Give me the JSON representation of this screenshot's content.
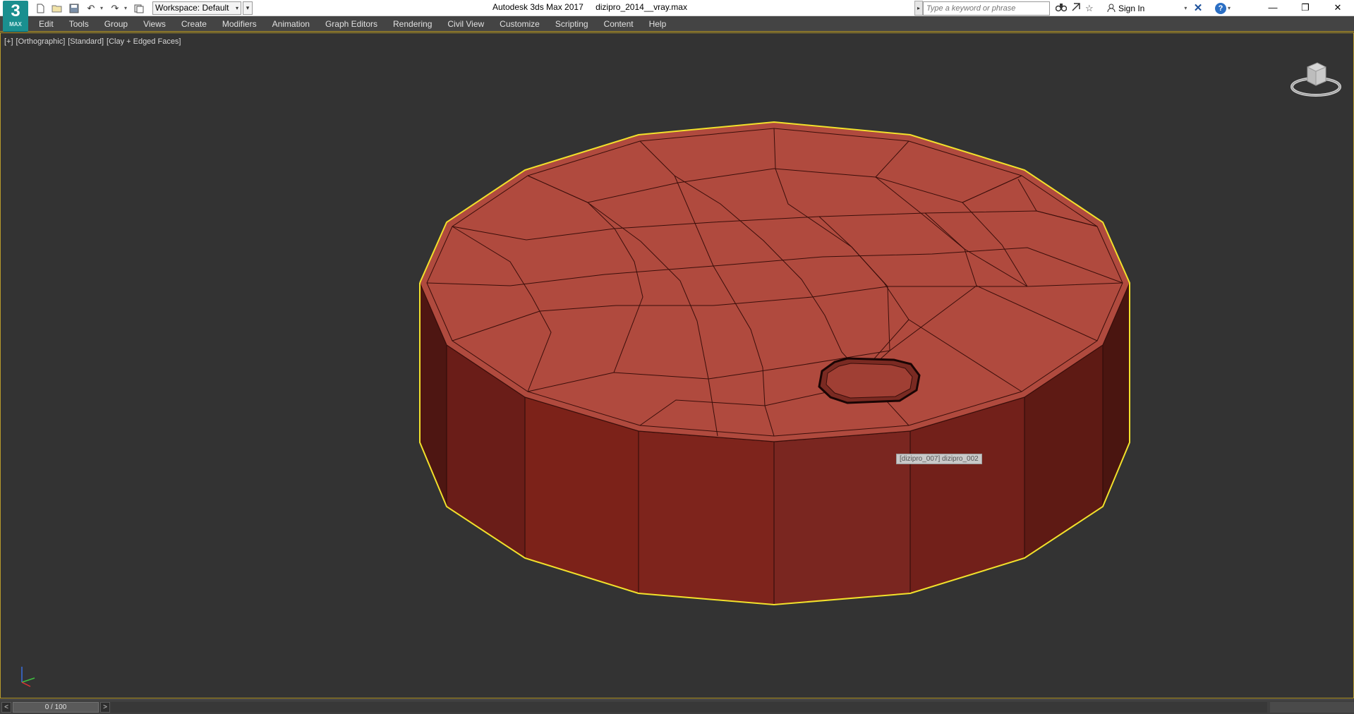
{
  "app": {
    "logo_text": "3",
    "logo_sub": "MAX",
    "title": "Autodesk 3ds Max 2017",
    "filename": "dizipro_2014__vray.max"
  },
  "quick_access": {
    "workspace_value": "Workspace: Default",
    "icons": [
      "new-file-icon",
      "open-file-icon",
      "save-icon",
      "undo-icon",
      "redo-icon",
      "project-folder-icon"
    ]
  },
  "infocenter": {
    "search_placeholder": "Type a keyword or phrase",
    "sign_in": "Sign In"
  },
  "window_controls": {
    "minimize": "—",
    "restore": "❐",
    "close": "✕"
  },
  "menu": {
    "items": [
      "Edit",
      "Tools",
      "Group",
      "Views",
      "Create",
      "Modifiers",
      "Animation",
      "Graph Editors",
      "Rendering",
      "Civil View",
      "Customize",
      "Scripting",
      "Content",
      "Help"
    ]
  },
  "viewport": {
    "label_plus": "[+]",
    "label_view": "[Orthographic]",
    "label_shading": "[Standard]",
    "label_style": "[Clay + Edged Faces]",
    "tooltip": "[dizipro_007] dizipro_002",
    "selection_color": "#f2e12b",
    "top_color": "#b04a3e",
    "side_color": "#7a221c"
  },
  "timeslider": {
    "prev": "<",
    "next": ">",
    "frame": "0 / 100"
  }
}
